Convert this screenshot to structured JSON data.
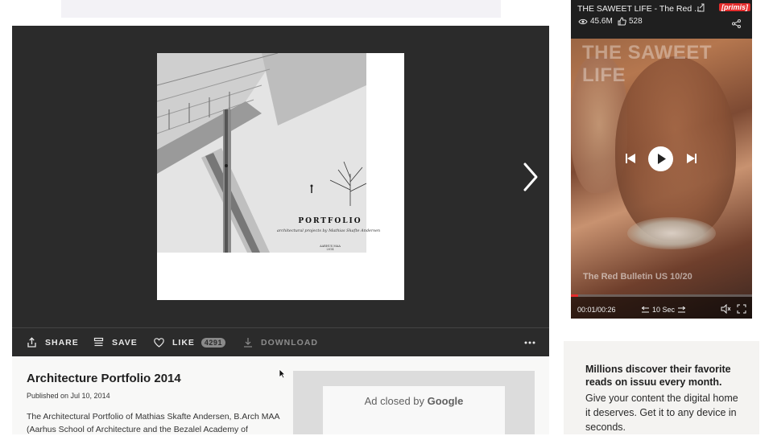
{
  "viewer": {
    "cover_title": "PORTFOLIO",
    "cover_subtitle": "architectural projects by Mathias Skafte Andersen",
    "cover_small_line1": "AARHUS MAA",
    "cover_small_line2": "2014"
  },
  "actions": {
    "share": "SHARE",
    "save": "SAVE",
    "like": "LIKE",
    "like_count": "4291",
    "download": "DOWNLOAD"
  },
  "document": {
    "title": "Architecture Portfolio 2014",
    "published": "Published on Jul 10, 2014",
    "description": "The Architectural Portfolio of Mathias Skafte Andersen, B.Arch MAA (Aarhus School of Architecture and the Bezalel Academy of"
  },
  "ad": {
    "closed_prefix": "Ad closed by ",
    "closed_brand": "Google"
  },
  "video": {
    "title": "THE SAWEET LIFE - The Red ...",
    "brand": "[primis]",
    "views": "45.6M",
    "likes": "528",
    "watermark": "THE SAWEET LIFE",
    "episode": "The Red Bulletin US 10/20",
    "time": "00:01/00:26",
    "seek_label": "10 Sec",
    "progress_fraction": 0.04
  },
  "promo": {
    "headline": "Millions discover their favorite reads on issuu every month.",
    "body": "Give your content the digital home it deserves. Get it to any device in seconds."
  },
  "colors": {
    "accent_red": "#e52d2d",
    "viewer_bg": "#2b2b2b"
  }
}
